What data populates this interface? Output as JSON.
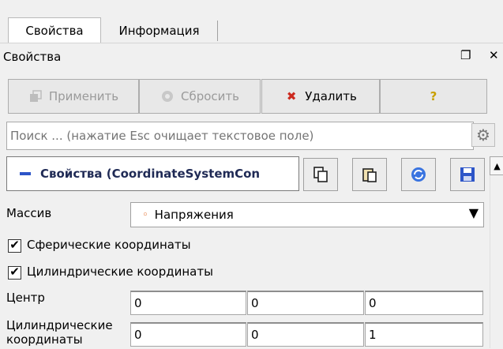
{
  "tabs": [
    {
      "label": "Свойства"
    },
    {
      "label": "Информация"
    }
  ],
  "dock": {
    "title": "Свойства",
    "float_icon": "float-icon",
    "close_icon": "close-icon"
  },
  "buttons": {
    "apply": {
      "label": "Применить",
      "icon": "apply-icon"
    },
    "reset": {
      "label": "Сбросить",
      "icon": "reset-icon"
    },
    "delete": {
      "label": "Удалить",
      "icon": "delete-icon"
    },
    "help": {
      "label": "?"
    }
  },
  "search": {
    "placeholder": "Поиск ... (нажатие Esc очищает текстовое поле)"
  },
  "section": {
    "title": "Свойства (CoordinateSystemCon"
  },
  "array": {
    "label": "Массив",
    "selected": "Напряжения"
  },
  "checkboxes": [
    {
      "label": "Сферические координаты",
      "checked": true
    },
    {
      "label": "Цилиндрические координаты",
      "checked": true
    }
  ],
  "center": {
    "label": "Центр",
    "values": [
      "0",
      "0",
      "0"
    ]
  },
  "cyl": {
    "label_line1": "Цилиндрические",
    "label_line2": "координаты",
    "values": [
      "0",
      "0",
      "1"
    ]
  },
  "colors": {
    "accent": "#2d55c8",
    "delete": "#cc2a1f",
    "help": "#c8a000"
  }
}
